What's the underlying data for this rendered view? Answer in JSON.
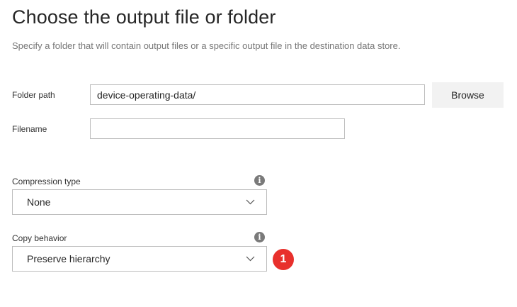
{
  "header": {
    "title": "Choose the output file or folder",
    "subtitle": "Specify a folder that will contain output files or a specific output file in the destination data store."
  },
  "folder_path": {
    "label": "Folder path",
    "value": "device-operating-data/",
    "browse_label": "Browse"
  },
  "filename": {
    "label": "Filename",
    "value": ""
  },
  "compression": {
    "label": "Compression type",
    "selected": "None",
    "info_icon": "info-icon"
  },
  "copy_behavior": {
    "label": "Copy behavior",
    "selected": "Preserve hierarchy",
    "info_icon": "info-icon"
  },
  "callout": {
    "number": "1",
    "color": "#e8302c"
  },
  "colors": {
    "border": "#bdbdbd",
    "button_bg": "#f2f2f2",
    "subtitle": "#767676"
  }
}
